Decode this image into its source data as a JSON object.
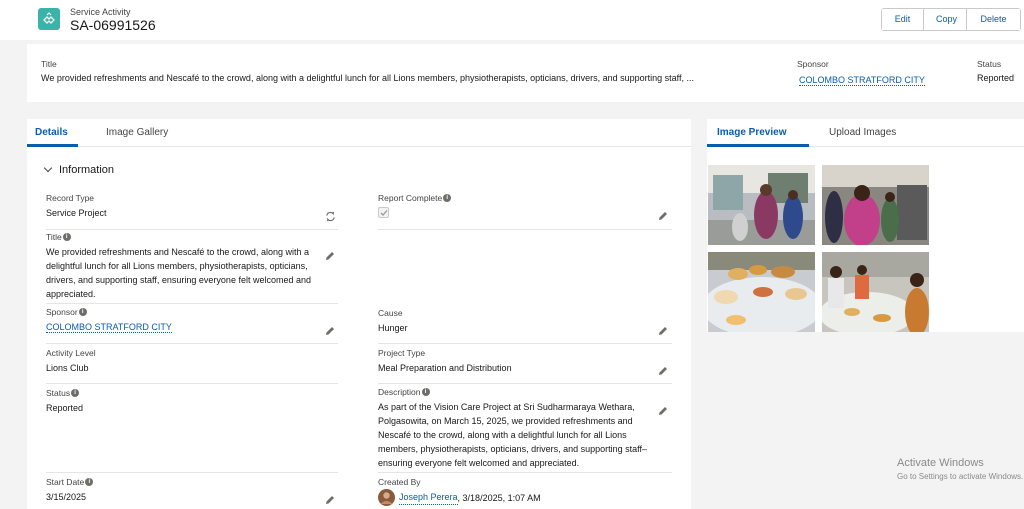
{
  "header": {
    "object_label": "Service Activity",
    "record_title": "SA-06991526",
    "edit_label": "Edit",
    "copy_label": "Copy",
    "delete_label": "Delete"
  },
  "highlights": {
    "title_label": "Title",
    "title_value": "We provided refreshments and Nescafé to the crowd, along with a delightful lunch for all Lions members, physiotherapists, opticians, drivers, and supporting staff, ...",
    "sponsor_label": "Sponsor",
    "sponsor_value": "COLOMBO STRATFORD CITY",
    "status_label": "Status",
    "status_value": "Reported"
  },
  "left_tabs": [
    "Details",
    "Image Gallery"
  ],
  "section_title": "Information",
  "fields": {
    "record_type": {
      "label": "Record Type",
      "value": "Service Project"
    },
    "report_complete": {
      "label": "Report Complete"
    },
    "title": {
      "label": "Title",
      "value": "We provided refreshments and Nescafé to the crowd, along with a delightful lunch for all Lions members, physiotherapists, opticians, drivers, and supporting staff, ensuring everyone felt welcomed and appreciated."
    },
    "sponsor": {
      "label": "Sponsor",
      "value": "COLOMBO STRATFORD CITY"
    },
    "cause": {
      "label": "Cause",
      "value": "Hunger"
    },
    "activity_level": {
      "label": "Activity Level",
      "value": "Lions Club"
    },
    "project_type": {
      "label": "Project Type",
      "value": "Meal Preparation and Distribution"
    },
    "status": {
      "label": "Status",
      "value": "Reported"
    },
    "description": {
      "label": "Description",
      "value": "As part of the Vision Care Project at Sri Sudharmaraya Wethara, Polgasowita, on March 15, 2025, we provided refreshments and Nescafé to the crowd, along with a delightful lunch for all Lions members, physiotherapists, opticians, drivers, and supporting staff–ensuring everyone felt welcomed and appreciated."
    },
    "start_date": {
      "label": "Start Date",
      "value": "3/15/2025"
    },
    "created_by": {
      "label": "Created By",
      "user": "Joseph Perera",
      "timestamp": ", 3/18/2025, 1:07 AM"
    }
  },
  "right_tabs": [
    "Image Preview",
    "Upload Images"
  ],
  "watermark": {
    "line1": "Activate Windows",
    "line2": "Go to Settings to activate Windows."
  },
  "colors": {
    "brand_blue": "#0b5cab",
    "icon_teal": "#3bb3a8",
    "page_bg": "#f3f3f3"
  }
}
